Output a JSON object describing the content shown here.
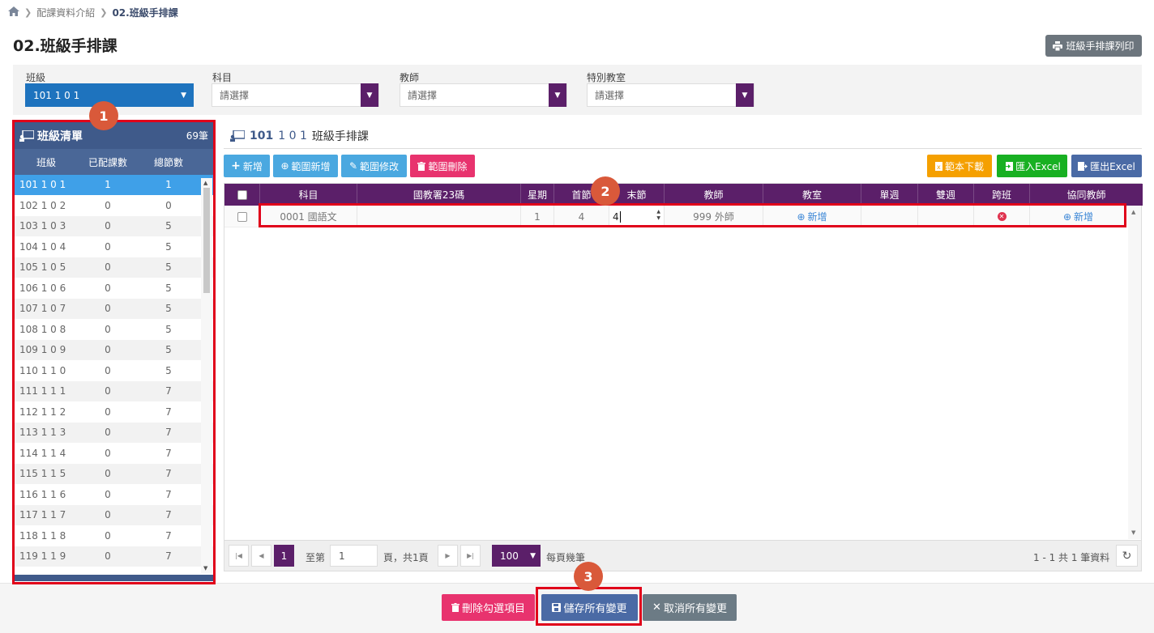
{
  "breadcrumb": {
    "item1": "配課資料介紹",
    "current": "02.班級手排課"
  },
  "page_title": "02.班級手排課",
  "print_button": "班級手排課列印",
  "filters": {
    "class_label": "班級",
    "class_value": "101 1 0 1",
    "subject_label": "科目",
    "subject_placeholder": "請選擇",
    "teacher_label": "教師",
    "teacher_placeholder": "請選擇",
    "room_label": "特別教室",
    "room_placeholder": "請選擇"
  },
  "class_list": {
    "title": "班級清單",
    "count": "69筆",
    "columns": [
      "班級",
      "已配課數",
      "總節數"
    ],
    "rows": [
      [
        "101 1 0 1",
        "1",
        "1"
      ],
      [
        "102 1 0 2",
        "0",
        "0"
      ],
      [
        "103 1 0 3",
        "0",
        "5"
      ],
      [
        "104 1 0 4",
        "0",
        "5"
      ],
      [
        "105 1 0 5",
        "0",
        "5"
      ],
      [
        "106 1 0 6",
        "0",
        "5"
      ],
      [
        "107 1 0 7",
        "0",
        "5"
      ],
      [
        "108 1 0 8",
        "0",
        "5"
      ],
      [
        "109 1 0 9",
        "0",
        "5"
      ],
      [
        "110 1 1 0",
        "0",
        "5"
      ],
      [
        "111 1 1 1",
        "0",
        "7"
      ],
      [
        "112 1 1 2",
        "0",
        "7"
      ],
      [
        "113 1 1 3",
        "0",
        "7"
      ],
      [
        "114 1 1 4",
        "0",
        "7"
      ],
      [
        "115 1 1 5",
        "0",
        "7"
      ],
      [
        "116 1 1 6",
        "0",
        "7"
      ],
      [
        "117 1 1 7",
        "0",
        "7"
      ],
      [
        "118 1 1 8",
        "0",
        "7"
      ],
      [
        "119 1 1 9",
        "0",
        "7"
      ]
    ]
  },
  "main": {
    "title_code": "101",
    "title_class": "1 0 1",
    "title_text": "班級手排課",
    "buttons": {
      "add": "新增",
      "range_add": "範圍新增",
      "range_edit": "範圍修改",
      "range_delete": "範圍刪除",
      "template_download": "範本下載",
      "import_excel": "匯入Excel",
      "export_excel": "匯出Excel"
    },
    "grid_columns": [
      "科目",
      "國教署23碼",
      "星期",
      "首節",
      "末節",
      "教師",
      "教室",
      "單週",
      "雙週",
      "跨班",
      "協同教師"
    ],
    "grid_row": {
      "subject": "0001 國語文",
      "code23": "",
      "weekday": "1",
      "first_period": "4",
      "last_period": "4",
      "teacher": "999 外師",
      "room": "新增",
      "single_week": "",
      "double_week": "",
      "cross_class": "",
      "co_teacher": "新增"
    },
    "pager": {
      "current_page": "1",
      "goto_label": "至第",
      "goto_value": "1",
      "page_suffix": "頁，共1頁",
      "page_size": "100",
      "page_size_label": "每頁幾筆",
      "summary": "1 - 1 共 1 筆資料"
    }
  },
  "bottom_buttons": {
    "delete_checked": "刪除勾選項目",
    "save_all": "儲存所有變更",
    "cancel_all": "取消所有變更"
  },
  "annotations": [
    "1",
    "2",
    "3"
  ],
  "colors": {
    "purple": "#5b1f69",
    "navy": "#3f5a8a",
    "highlight": "#3fa0e8",
    "annotation_red": "#e0001a",
    "badge": "#d9593a"
  }
}
